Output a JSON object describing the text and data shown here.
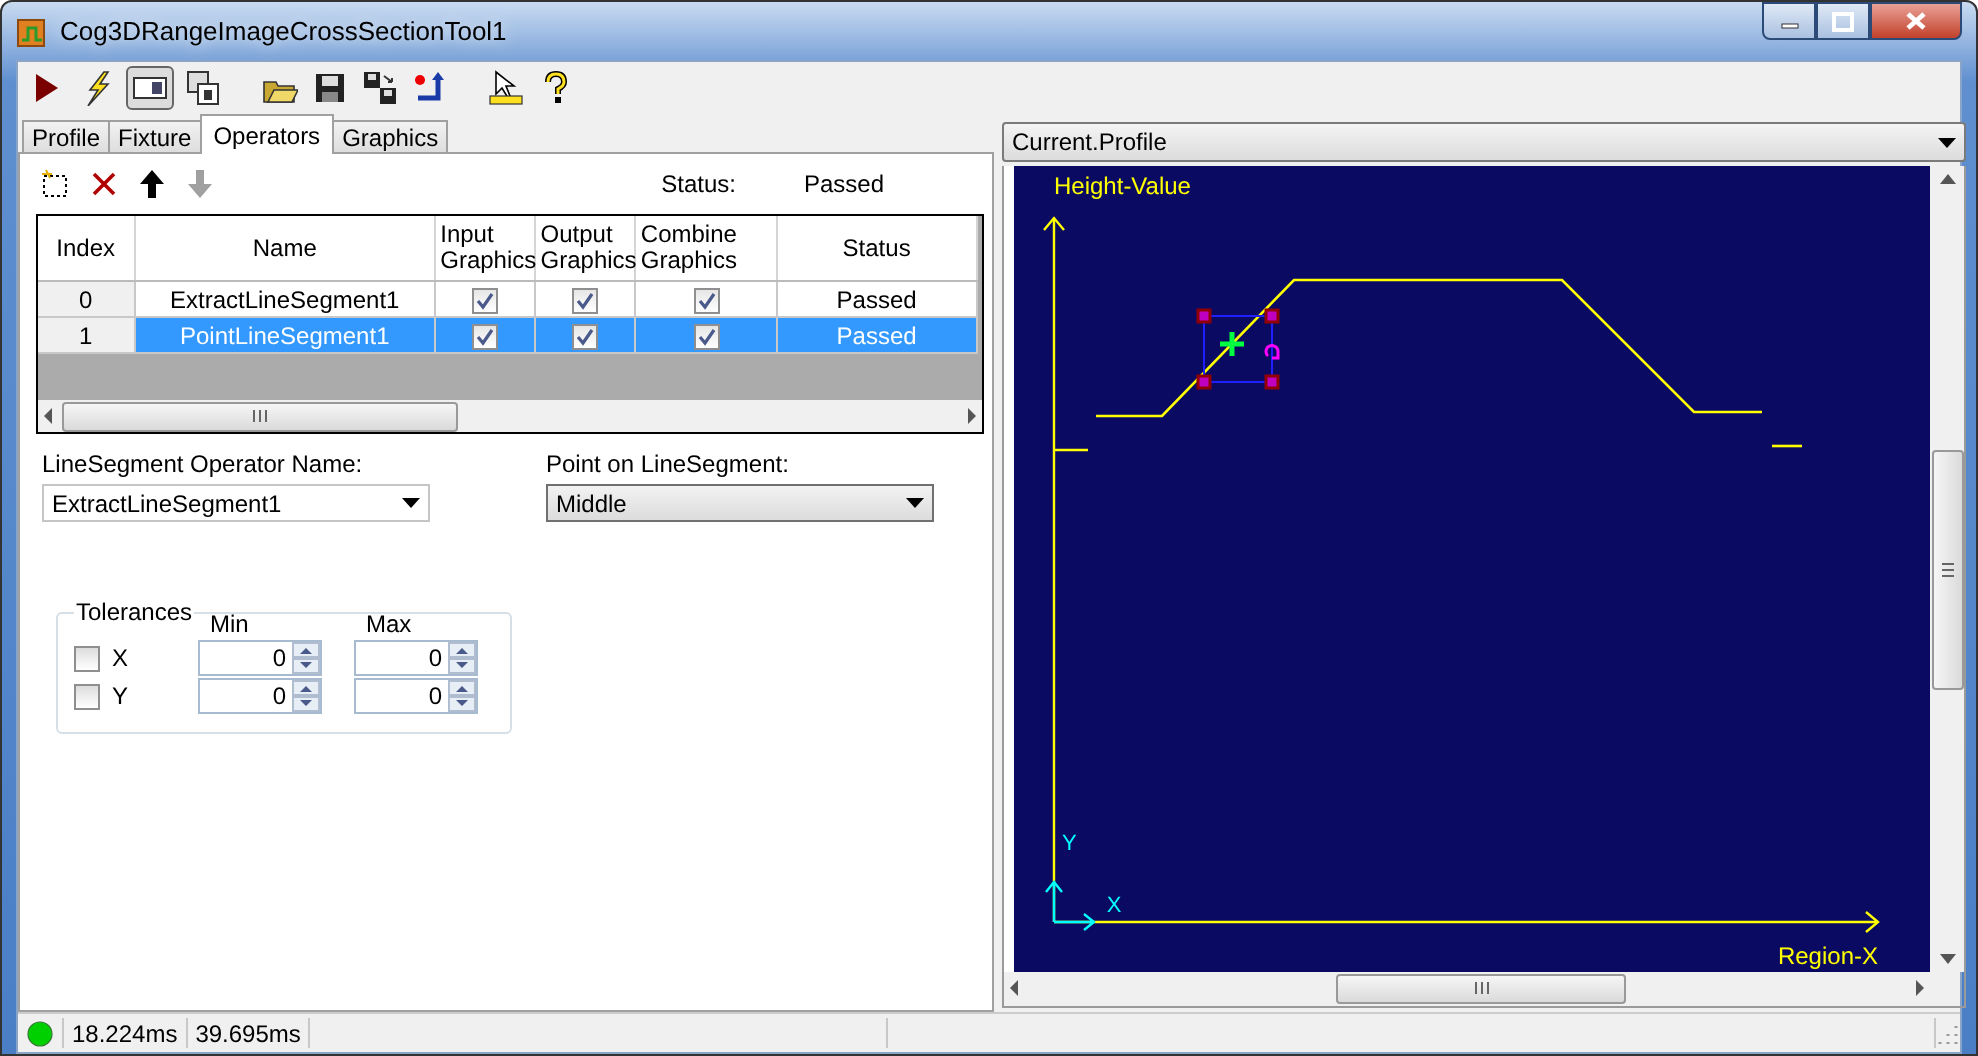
{
  "window": {
    "title": "Cog3DRangeImageCrossSectionTool1"
  },
  "toolbar": [
    {
      "kind": "run",
      "pressed": false
    },
    {
      "kind": "flash",
      "pressed": false
    },
    {
      "kind": "panel",
      "pressed": true
    },
    {
      "kind": "windows",
      "pressed": false
    },
    {
      "kind": "open",
      "pressed": false
    },
    {
      "kind": "save",
      "pressed": false
    },
    {
      "kind": "save_all",
      "pressed": false
    },
    {
      "kind": "reset",
      "pressed": false
    },
    {
      "kind": "pointer",
      "pressed": false
    },
    {
      "kind": "help",
      "pressed": false
    }
  ],
  "tabs": [
    {
      "label": "Profile",
      "selected": false
    },
    {
      "label": "Fixture",
      "selected": false
    },
    {
      "label": "Operators",
      "selected": true
    },
    {
      "label": "Graphics",
      "selected": false
    }
  ],
  "operators": {
    "tools": [
      {
        "kind": "add",
        "disabled": false
      },
      {
        "kind": "delete",
        "disabled": false
      },
      {
        "kind": "up",
        "disabled": false
      },
      {
        "kind": "down",
        "disabled": true
      }
    ],
    "status_label": "Status:",
    "status_value": "Passed",
    "table": {
      "columns": [
        "Index",
        "Name",
        "Input Graphics",
        "Output Graphics",
        "Combine Graphics",
        "Status"
      ],
      "rows": [
        {
          "index": "0",
          "name": "ExtractLineSegment1",
          "input_graphics": true,
          "output_graphics": true,
          "combine_graphics": true,
          "status": "Passed",
          "selected": false
        },
        {
          "index": "1",
          "name": "PointLineSegment1",
          "input_graphics": true,
          "output_graphics": true,
          "combine_graphics": true,
          "status": "Passed",
          "selected": true
        }
      ]
    },
    "operator_name": {
      "label": "LineSegment Operator Name:",
      "value": "ExtractLineSegment1"
    },
    "point": {
      "label": "Point on LineSegment:",
      "value": "Middle"
    },
    "tolerances": {
      "title": "Tolerances",
      "min_label": "Min",
      "max_label": "Max",
      "rows": [
        {
          "label": "X",
          "checked": false,
          "min": "0",
          "max": "0"
        },
        {
          "label": "Y",
          "checked": false,
          "min": "0",
          "max": "0"
        }
      ]
    }
  },
  "view": {
    "selector": "Current.Profile",
    "y_label": "Height-Value",
    "x_label": "Region-X",
    "axis_x": "X",
    "axis_y": "Y"
  },
  "status_bar": {
    "times": [
      "18.224ms",
      "39.695ms"
    ]
  }
}
